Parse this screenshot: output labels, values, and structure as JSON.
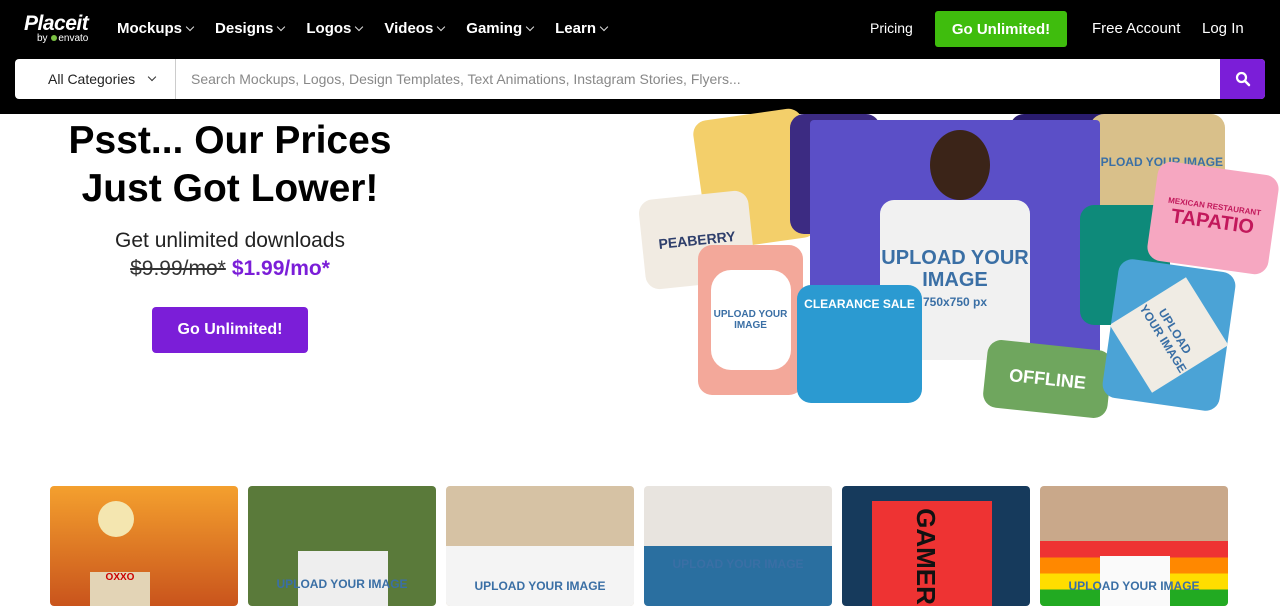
{
  "header": {
    "logo": "Placeit",
    "logo_sub": "envato",
    "logo_by": "by",
    "nav": [
      "Mockups",
      "Designs",
      "Logos",
      "Videos",
      "Gaming",
      "Learn"
    ],
    "pricing": "Pricing",
    "go_unlimited": "Go Unlimited!",
    "free_account": "Free Account",
    "log_in": "Log In"
  },
  "search": {
    "category": "All Categories",
    "placeholder": "Search Mockups, Logos, Design Templates, Text Animations, Instagram Stories, Flyers..."
  },
  "hero": {
    "title": "Psst... Our Prices Just Got Lower!",
    "subtitle": "Get unlimited downloads",
    "old_price": "$9.99/mo*",
    "new_price": "$1.99/mo*",
    "cta": "Go Unlimited!",
    "collage": {
      "peaberry": "PEABERRY",
      "tapatio": "TAPATIO",
      "upload": "UPLOAD YOUR IMAGE",
      "size": "750x750 px",
      "clearance": "CLEARANCE SALE",
      "offline": "OFFLINE",
      "mexican": "MEXICAN RESTAURANT"
    }
  },
  "thumbnails": {
    "upload": "UPLOAD YOUR IMAGE",
    "oxxo": "OXXO",
    "gamer": "GAMER"
  },
  "colors": {
    "accent": "#7b1ed8",
    "green": "#3fbd0d"
  }
}
